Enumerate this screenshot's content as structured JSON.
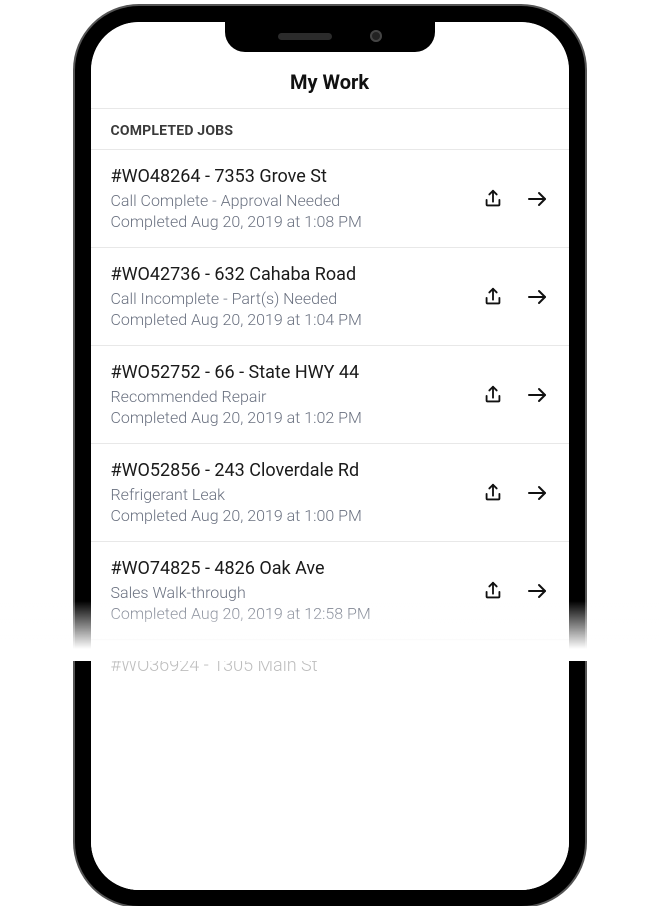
{
  "header": {
    "title": "My Work"
  },
  "section_label": "COMPLETED JOBS",
  "jobs": [
    {
      "title": "#WO48264 - 7353 Grove St",
      "status": "Call Complete - Approval Needed",
      "completed": "Completed Aug 20, 2019 at 1:08 PM"
    },
    {
      "title": "#WO42736 - 632 Cahaba Road",
      "status": "Call Incomplete - Part(s) Needed",
      "completed": "Completed Aug 20, 2019 at 1:04 PM"
    },
    {
      "title": "#WO52752 - 66 - State HWY 44",
      "status": "Recommended Repair",
      "completed": "Completed Aug 20, 2019 at 1:02 PM"
    },
    {
      "title": "#WO52856 - 243 Cloverdale Rd",
      "status": "Refrigerant Leak",
      "completed": "Completed Aug 20, 2019 at 1:00 PM"
    },
    {
      "title": "#WO74825 - 4826 Oak Ave",
      "status": "Sales Walk-through",
      "completed": "Completed Aug 20, 2019 at 12:58 PM"
    }
  ],
  "partial_next": "#WO36924 - 1305 Main St"
}
